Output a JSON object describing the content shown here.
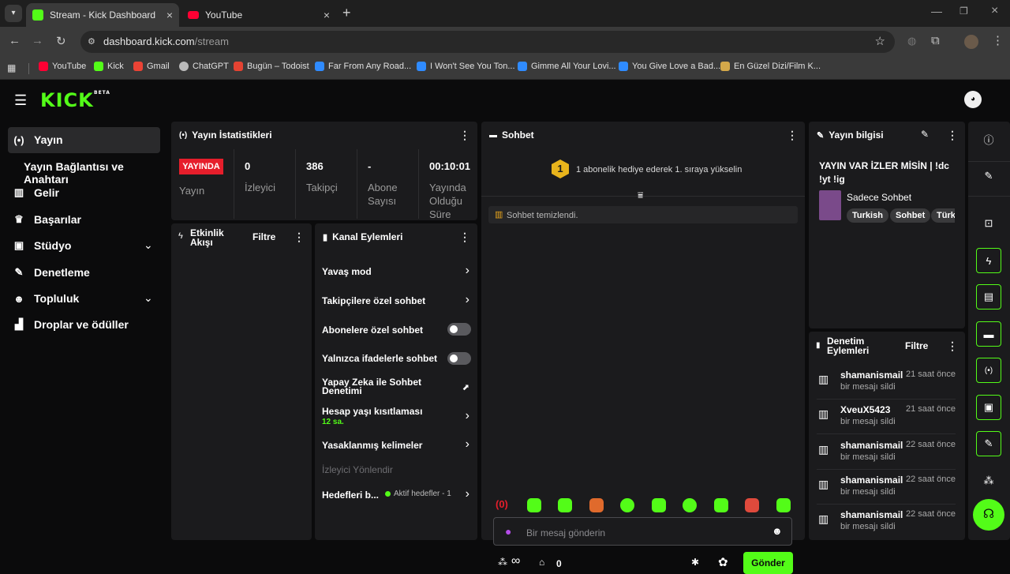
{
  "browser": {
    "tabs": [
      {
        "title": "Stream - Kick Dashboard",
        "favicon": "kick-icon"
      },
      {
        "title": "YouTube",
        "favicon": "youtube-icon"
      }
    ],
    "new_tab": "+",
    "url_domain": "dashboard.kick.com",
    "url_path": "/stream",
    "bookmarks": [
      "YouTube",
      "Kick",
      "Gmail",
      "ChatGPT",
      "Bugün – Todoist",
      "Far From Any Road...",
      "I Won't See You Ton...",
      "Gimme All Your Lovi...",
      "You Give Love a Bad...",
      "En Güzel Dizi/Film K..."
    ]
  },
  "app": {
    "logo": "KICK",
    "logo_badge": "BETA",
    "accent": "#53fc18"
  },
  "sidebar": {
    "items": [
      {
        "label": "Yayın",
        "icon": "broadcast-icon",
        "active": true
      },
      {
        "label": "Yayın Bağlantısı ve Anahtarı",
        "icon": ""
      },
      {
        "label": "Gelir",
        "icon": "chart-icon"
      },
      {
        "label": "Başarılar",
        "icon": "trophy-icon"
      },
      {
        "label": "Stüdyo",
        "icon": "studio-icon",
        "expandable": true
      },
      {
        "label": "Denetleme",
        "icon": "wrench-icon"
      },
      {
        "label": "Topluluk",
        "icon": "community-icon",
        "expandable": true
      },
      {
        "label": "Droplar ve ödüller",
        "icon": "gift-icon"
      }
    ]
  },
  "stats": {
    "title": "Yayın İstatistikleri",
    "live_badge": "YAYINDA",
    "live_label": "Yayın",
    "columns": [
      {
        "value": "0",
        "label": "İzleyici"
      },
      {
        "value": "386",
        "label": "Takipçi"
      },
      {
        "value": "-",
        "label": "Abone Sayısı"
      },
      {
        "value": "00:10:01",
        "label": "Yayında Olduğu Süre"
      }
    ]
  },
  "activity": {
    "title": "Etkinlik Akışı",
    "filter": "Filtre"
  },
  "channel_actions": {
    "title": "Kanal Eylemleri",
    "items": [
      {
        "label": "Yavaş mod",
        "control": "chevron"
      },
      {
        "label": "Takipçilere özel sohbet",
        "control": "chevron"
      },
      {
        "label": "Abonelere özel sohbet",
        "control": "toggle"
      },
      {
        "label": "Yalnızca ifadelerle sohbet",
        "control": "toggle"
      },
      {
        "label": "Yapay Zeka ile Sohbet Denetimi",
        "control": "external"
      },
      {
        "label": "Hesap yaşı kısıtlaması",
        "sub": "12 sa.",
        "control": "chevron"
      },
      {
        "label": "Yasaklanmış kelimeler",
        "control": "chevron"
      }
    ],
    "section_label": "İzleyici Yönlendir",
    "goals_label": "Hedefleri b...",
    "goals_status": "Aktif hedefler - 1"
  },
  "chat": {
    "title": "Sohbet",
    "gift_rank": "1",
    "gift_prompt": "1 abonelik hediye ederek 1. sıraya yükselin",
    "cleared_message": "Sohbet temizlendi.",
    "input_placeholder": "Bir mesaj gönderin",
    "points_value": "∞",
    "store_value": "0",
    "send_label": "Gönder"
  },
  "stream_info": {
    "title": "Yayın bilgisi",
    "stream_title": "YAYIN VAR İZLER MİSİN | !dc !yt !ig",
    "category": "Sadece Sohbet",
    "tags": [
      "Turkish",
      "Sohbet",
      "Türk"
    ]
  },
  "moderation": {
    "title": "Denetim Eylemleri",
    "filter": "Filtre",
    "rows": [
      {
        "user": "shamanismail",
        "action": "bir mesajı sildi",
        "time": "21 saat önce"
      },
      {
        "user": "XveuX5423",
        "action": "bir mesajı sildi",
        "time": "21 saat önce"
      },
      {
        "user": "shamanismail",
        "action": "bir mesajı sildi",
        "time": "22 saat önce"
      },
      {
        "user": "shamanismail",
        "action": "bir mesajı sildi",
        "time": "22 saat önce"
      },
      {
        "user": "shamanismail",
        "action": "bir mesajı sildi",
        "time": "22 saat önce"
      }
    ]
  }
}
